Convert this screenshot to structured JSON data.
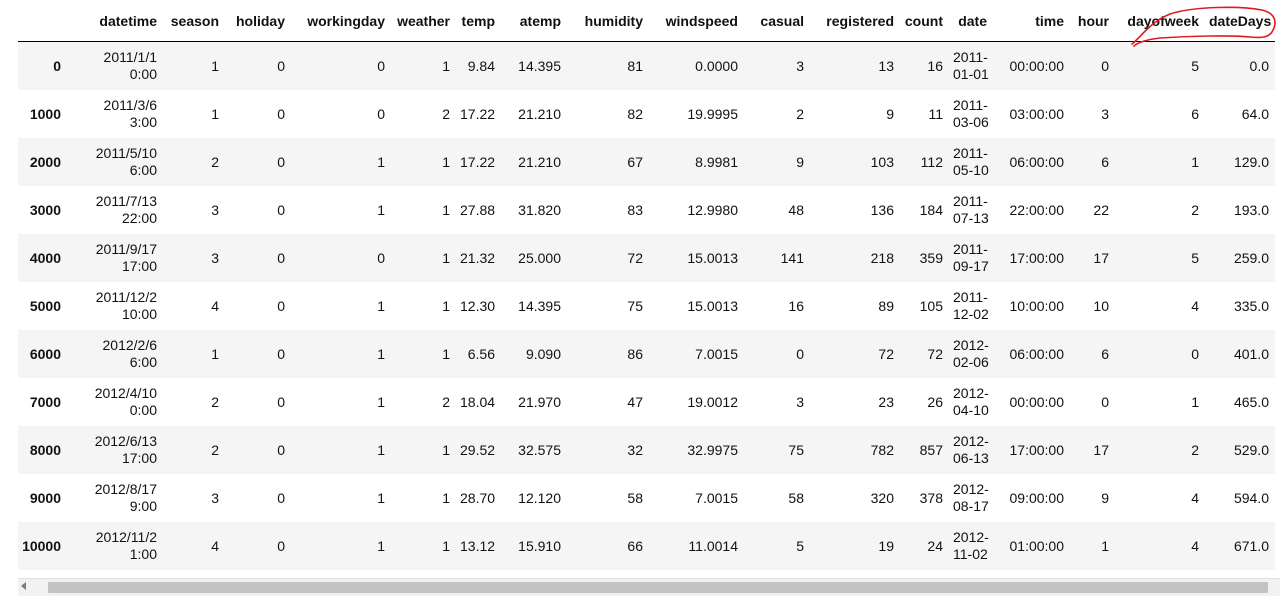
{
  "table": {
    "columns": [
      "",
      "datetime",
      "season",
      "holiday",
      "workingday",
      "weather",
      "temp",
      "atemp",
      "humidity",
      "windspeed",
      "casual",
      "registered",
      "count",
      "date",
      "time",
      "hour",
      "dayofweek",
      "dateDays"
    ],
    "rows": [
      {
        "index": "0",
        "datetime": [
          "2011/1/1",
          "0:00"
        ],
        "season": "1",
        "holiday": "0",
        "workingday": "0",
        "weather": "1",
        "temp": "9.84",
        "atemp": "14.395",
        "humidity": "81",
        "windspeed": "0.0000",
        "casual": "3",
        "registered": "13",
        "count": "16",
        "date": [
          "2011-",
          "01-01"
        ],
        "time": "00:00:00",
        "hour": "0",
        "dayofweek": "5",
        "dateDays": "0.0"
      },
      {
        "index": "1000",
        "datetime": [
          "2011/3/6",
          "3:00"
        ],
        "season": "1",
        "holiday": "0",
        "workingday": "0",
        "weather": "2",
        "temp": "17.22",
        "atemp": "21.210",
        "humidity": "82",
        "windspeed": "19.9995",
        "casual": "2",
        "registered": "9",
        "count": "11",
        "date": [
          "2011-",
          "03-06"
        ],
        "time": "03:00:00",
        "hour": "3",
        "dayofweek": "6",
        "dateDays": "64.0"
      },
      {
        "index": "2000",
        "datetime": [
          "2011/5/10",
          "6:00"
        ],
        "season": "2",
        "holiday": "0",
        "workingday": "1",
        "weather": "1",
        "temp": "17.22",
        "atemp": "21.210",
        "humidity": "67",
        "windspeed": "8.9981",
        "casual": "9",
        "registered": "103",
        "count": "112",
        "date": [
          "2011-",
          "05-10"
        ],
        "time": "06:00:00",
        "hour": "6",
        "dayofweek": "1",
        "dateDays": "129.0"
      },
      {
        "index": "3000",
        "datetime": [
          "2011/7/13",
          "22:00"
        ],
        "season": "3",
        "holiday": "0",
        "workingday": "1",
        "weather": "1",
        "temp": "27.88",
        "atemp": "31.820",
        "humidity": "83",
        "windspeed": "12.9980",
        "casual": "48",
        "registered": "136",
        "count": "184",
        "date": [
          "2011-",
          "07-13"
        ],
        "time": "22:00:00",
        "hour": "22",
        "dayofweek": "2",
        "dateDays": "193.0"
      },
      {
        "index": "4000",
        "datetime": [
          "2011/9/17",
          "17:00"
        ],
        "season": "3",
        "holiday": "0",
        "workingday": "0",
        "weather": "1",
        "temp": "21.32",
        "atemp": "25.000",
        "humidity": "72",
        "windspeed": "15.0013",
        "casual": "141",
        "registered": "218",
        "count": "359",
        "date": [
          "2011-",
          "09-17"
        ],
        "time": "17:00:00",
        "hour": "17",
        "dayofweek": "5",
        "dateDays": "259.0"
      },
      {
        "index": "5000",
        "datetime": [
          "2011/12/2",
          "10:00"
        ],
        "season": "4",
        "holiday": "0",
        "workingday": "1",
        "weather": "1",
        "temp": "12.30",
        "atemp": "14.395",
        "humidity": "75",
        "windspeed": "15.0013",
        "casual": "16",
        "registered": "89",
        "count": "105",
        "date": [
          "2011-",
          "12-02"
        ],
        "time": "10:00:00",
        "hour": "10",
        "dayofweek": "4",
        "dateDays": "335.0"
      },
      {
        "index": "6000",
        "datetime": [
          "2012/2/6",
          "6:00"
        ],
        "season": "1",
        "holiday": "0",
        "workingday": "1",
        "weather": "1",
        "temp": "6.56",
        "atemp": "9.090",
        "humidity": "86",
        "windspeed": "7.0015",
        "casual": "0",
        "registered": "72",
        "count": "72",
        "date": [
          "2012-",
          "02-06"
        ],
        "time": "06:00:00",
        "hour": "6",
        "dayofweek": "0",
        "dateDays": "401.0"
      },
      {
        "index": "7000",
        "datetime": [
          "2012/4/10",
          "0:00"
        ],
        "season": "2",
        "holiday": "0",
        "workingday": "1",
        "weather": "2",
        "temp": "18.04",
        "atemp": "21.970",
        "humidity": "47",
        "windspeed": "19.0012",
        "casual": "3",
        "registered": "23",
        "count": "26",
        "date": [
          "2012-",
          "04-10"
        ],
        "time": "00:00:00",
        "hour": "0",
        "dayofweek": "1",
        "dateDays": "465.0"
      },
      {
        "index": "8000",
        "datetime": [
          "2012/6/13",
          "17:00"
        ],
        "season": "2",
        "holiday": "0",
        "workingday": "1",
        "weather": "1",
        "temp": "29.52",
        "atemp": "32.575",
        "humidity": "32",
        "windspeed": "32.9975",
        "casual": "75",
        "registered": "782",
        "count": "857",
        "date": [
          "2012-",
          "06-13"
        ],
        "time": "17:00:00",
        "hour": "17",
        "dayofweek": "2",
        "dateDays": "529.0"
      },
      {
        "index": "9000",
        "datetime": [
          "2012/8/17",
          "9:00"
        ],
        "season": "3",
        "holiday": "0",
        "workingday": "1",
        "weather": "1",
        "temp": "28.70",
        "atemp": "12.120",
        "humidity": "58",
        "windspeed": "7.0015",
        "casual": "58",
        "registered": "320",
        "count": "378",
        "date": [
          "2012-",
          "08-17"
        ],
        "time": "09:00:00",
        "hour": "9",
        "dayofweek": "4",
        "dateDays": "594.0"
      },
      {
        "index": "10000",
        "datetime": [
          "2012/11/2",
          "1:00"
        ],
        "season": "4",
        "holiday": "0",
        "workingday": "1",
        "weather": "1",
        "temp": "13.12",
        "atemp": "15.910",
        "humidity": "66",
        "windspeed": "11.0014",
        "casual": "5",
        "registered": "19",
        "count": "24",
        "date": [
          "2012-",
          "11-02"
        ],
        "time": "01:00:00",
        "hour": "1",
        "dayofweek": "4",
        "dateDays": "671.0"
      }
    ]
  },
  "annotation": {
    "color": "#e0191f",
    "shape": "hand-drawn-arc-around-dayofweek-dateDays-headers"
  },
  "scrollbar": {
    "left_arrow_icon": "arrow-left-icon"
  }
}
